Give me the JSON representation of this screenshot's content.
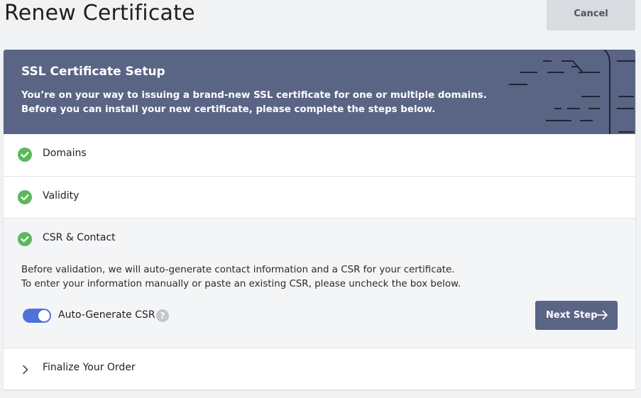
{
  "page": {
    "title": "Renew Certificate",
    "cancel_label": "Cancel"
  },
  "banner": {
    "title": "SSL Certificate Setup",
    "line1": "You’re on your way to issuing a brand-new SSL certificate for one or multiple domains.",
    "line2": "Before you can install your new certificate, please complete the steps below."
  },
  "steps": [
    {
      "label": "Domains",
      "status": "complete"
    },
    {
      "label": "Validity",
      "status": "complete"
    },
    {
      "label": "CSR & Contact",
      "status": "complete"
    },
    {
      "label": "Finalize Your Order",
      "status": "collapsed"
    }
  ],
  "csr": {
    "desc_line1": "Before validation, we will auto-generate contact information and a CSR for your certificate.",
    "desc_line2": "To enter your information manually or paste an existing CSR, please uncheck the box below.",
    "toggle_label": "Auto-Generate CSR",
    "toggle_on": true,
    "help_glyph": "?",
    "next_label": "Next Step"
  },
  "colors": {
    "banner": "#5a6484",
    "check": "#5cb85c",
    "toggle": "#4f72d9",
    "button": "#5a6484"
  },
  "icons": {
    "check": "check-circle-icon",
    "help": "question-circle-icon",
    "arrow": "arrow-right-icon",
    "chevron": "chevron-right-icon"
  }
}
